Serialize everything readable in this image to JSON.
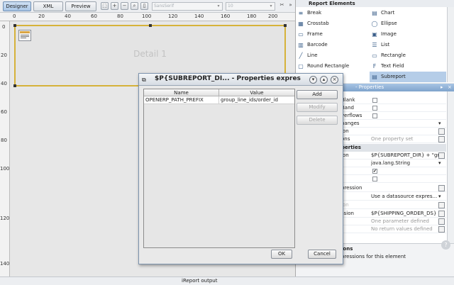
{
  "toolbar": {
    "tabs": [
      {
        "label": "Designer"
      },
      {
        "label": "XML"
      },
      {
        "label": "Preview"
      }
    ],
    "font_combo": "SansSerif",
    "size_combo": "10"
  },
  "ruler": {
    "h_labels": [
      "0",
      "20",
      "40",
      "60",
      "80",
      "100",
      "120",
      "140",
      "160",
      "180",
      "200"
    ],
    "v_labels": [
      "0",
      "20",
      "40",
      "60",
      "80",
      "100",
      "120",
      "140"
    ]
  },
  "canvas": {
    "band_label": "Detail 1"
  },
  "palette": {
    "title": "Report Elements",
    "items": [
      {
        "label": "Break",
        "icon": "break-icon",
        "glyph": "≡"
      },
      {
        "label": "Chart",
        "icon": "chart-icon",
        "glyph": "▤"
      },
      {
        "label": "Crosstab",
        "icon": "crosstab-icon",
        "glyph": "▦"
      },
      {
        "label": "Ellipse",
        "icon": "ellipse-icon",
        "glyph": "◯"
      },
      {
        "label": "Frame",
        "icon": "frame-icon",
        "glyph": "▭"
      },
      {
        "label": "Image",
        "icon": "image-icon",
        "glyph": "▣"
      },
      {
        "label": "Barcode",
        "icon": "barcode-icon",
        "glyph": "▥"
      },
      {
        "label": "List",
        "icon": "list-icon",
        "glyph": "☰"
      },
      {
        "label": "Line",
        "icon": "line-icon",
        "glyph": "╱"
      },
      {
        "label": "Rectangle",
        "icon": "rectangle-icon",
        "glyph": "▭"
      },
      {
        "label": "Round Rectangle",
        "icon": "round-rectangle-icon",
        "glyph": "▢"
      },
      {
        "label": "Text Field",
        "icon": "text-field-icon",
        "glyph": "F"
      },
      {
        "label": "Subreport",
        "icon": "subreport-icon",
        "glyph": "▤"
      }
    ]
  },
  "properties": {
    "header": "- Properties",
    "rows": [
      {
        "key": "Blank",
        "type": "checkbox",
        "checked": false
      },
      {
        "key": "Band",
        "type": "checkbox",
        "checked": false
      },
      {
        "key": "verflows",
        "type": "checkbox",
        "checked": false
      },
      {
        "key": "hanges",
        "type": "dropdown",
        "value": ""
      },
      {
        "key": "ion",
        "type": "text",
        "value": ""
      },
      {
        "key": "ons",
        "type": "text",
        "value": "One property set",
        "dim": true
      },
      {
        "key": "perties",
        "type": "section"
      },
      {
        "key": "ion",
        "type": "text",
        "value": "$P{SUBREPORT_DIR} + \"gr..."
      },
      {
        "key": "",
        "type": "dropdown",
        "value": "java.lang.String"
      },
      {
        "key": "",
        "type": "checkbox",
        "checked": true
      },
      {
        "key": "",
        "type": "checkbox",
        "checked": false
      },
      {
        "key": "pression",
        "type": "text",
        "value": ""
      },
      {
        "key": "",
        "type": "dropdown",
        "value": "Use a datasource expres..."
      },
      {
        "key": "ion",
        "type": "text",
        "value": "",
        "dim": true
      },
      {
        "key": "ssion",
        "type": "text",
        "value": "$P{SHIPPING_ORDER_DS}"
      },
      {
        "key": "",
        "type": "text",
        "value": "One parameter defined",
        "dim": true
      },
      {
        "key": "",
        "type": "text",
        "value": "No return values defined",
        "dim": true
      }
    ],
    "desc_title": "ions",
    "desc_text": "pressions for this element"
  },
  "dialog": {
    "title": "$P{SUBREPORT_DI... - Properties expres",
    "columns": [
      "Name",
      "Value"
    ],
    "rows": [
      {
        "name": "OPENERP_PATH_PREFIX",
        "value": "group_line_ids/order_id"
      }
    ],
    "buttons": {
      "add": "Add",
      "modify": "Modify",
      "delete": "Delete",
      "ok": "OK",
      "cancel": "Cancel"
    }
  },
  "status": {
    "output": "iReport output"
  }
}
